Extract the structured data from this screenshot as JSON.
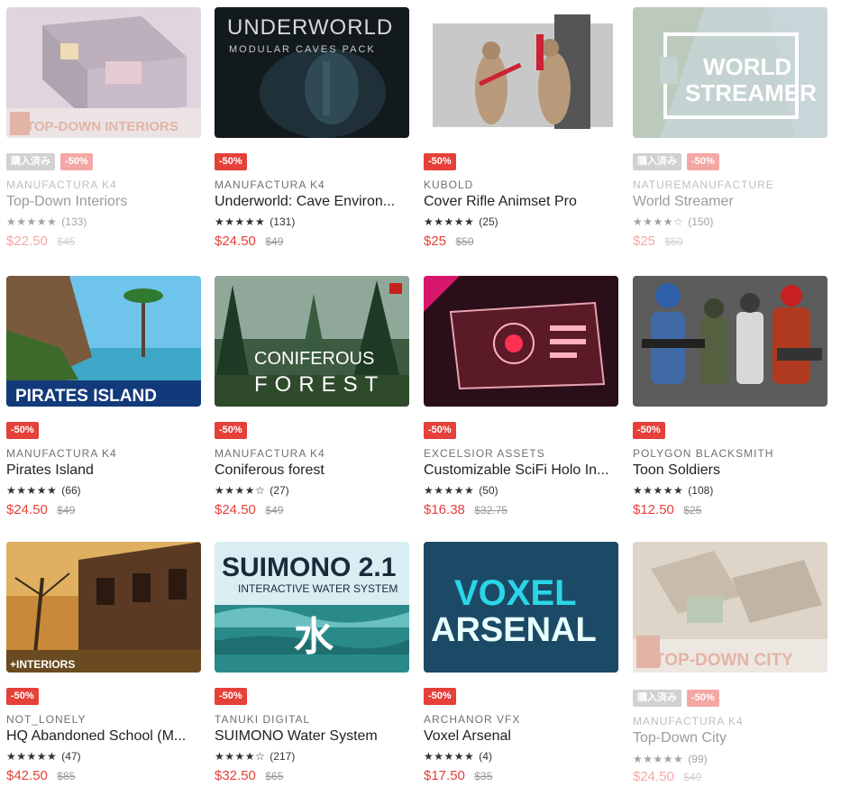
{
  "colors": {
    "sale_badge": "#e5403a",
    "owned_badge": "#9a9a9a",
    "price": "#e5403a",
    "original_price": "#999999"
  },
  "products": [
    {
      "publisher": "MANUFACTURA K4",
      "title": "Top-Down Interiors",
      "stars": "★★★★★",
      "reviews": "(133)",
      "price": "$22.50",
      "original_price": "$45",
      "owned_label": "購入済み",
      "sale_label": "-50%",
      "thumb_text": "TOP-DOWN INTERIORS",
      "thumb_icon": "interior-room-image",
      "faded": true
    },
    {
      "publisher": "MANUFACTURA K4",
      "title": "Underworld: Cave Environ...",
      "stars": "★★★★★",
      "reviews": "(131)",
      "price": "$24.50",
      "original_price": "$49",
      "sale_label": "-50%",
      "thumb_text": "UNDERWORLD",
      "thumb_subtext": "MODULAR CAVES PACK",
      "thumb_icon": "cave-image"
    },
    {
      "publisher": "KUBOLD",
      "title": "Cover Rifle Animset Pro",
      "stars": "★★★★★",
      "reviews": "(25)",
      "price": "$25",
      "original_price": "$50",
      "sale_label": "-50%",
      "thumb_icon": "soldier-figures-image"
    },
    {
      "publisher": "NATUREMANUFACTURE",
      "title": "World Streamer",
      "stars": "★★★★☆",
      "reviews": "(150)",
      "price": "$25",
      "original_price": "$50",
      "owned_label": "購入済み",
      "sale_label": "-50%",
      "thumb_text": "WORLD",
      "thumb_subtext": "STREAMER",
      "thumb_icon": "landscape-image",
      "faded": true
    },
    {
      "publisher": "MANUFACTURA K4",
      "title": "Pirates Island",
      "stars": "★★★★★",
      "reviews": "(66)",
      "price": "$24.50",
      "original_price": "$49",
      "sale_label": "-50%",
      "thumb_text": "PIRATES ISLAND",
      "thumb_icon": "island-image"
    },
    {
      "publisher": "MANUFACTURA K4",
      "title": "Coniferous forest",
      "stars": "★★★★☆",
      "reviews": "(27)",
      "price": "$24.50",
      "original_price": "$49",
      "sale_label": "-50%",
      "thumb_text": "CONIFEROUS",
      "thumb_subtext": "FOREST",
      "thumb_icon": "forest-image"
    },
    {
      "publisher": "EXCELSIOR ASSETS",
      "title": "Customizable SciFi Holo In...",
      "stars": "★★★★★",
      "reviews": "(50)",
      "price": "$16.38",
      "original_price": "$32.75",
      "sale_label": "-50%",
      "thumb_icon": "holo-interface-image"
    },
    {
      "publisher": "POLYGON BLACKSMITH",
      "title": "Toon Soldiers",
      "stars": "★★★★★",
      "reviews": "(108)",
      "price": "$12.50",
      "original_price": "$25",
      "sale_label": "-50%",
      "thumb_icon": "toon-soldiers-image"
    },
    {
      "publisher": "NOT_LONELY",
      "title": "HQ Abandoned School (M...",
      "stars": "★★★★★",
      "reviews": "(47)",
      "price": "$42.50",
      "original_price": "$85",
      "sale_label": "-50%",
      "thumb_text": "+INTERIORS",
      "thumb_icon": "school-image"
    },
    {
      "publisher": "TANUKI DIGITAL",
      "title": "SUIMONO Water System",
      "stars": "★★★★☆",
      "reviews": "(217)",
      "price": "$32.50",
      "original_price": "$65",
      "sale_label": "-50%",
      "thumb_text": "SUIMONO 2.1",
      "thumb_subtext": "INTERACTIVE WATER SYSTEM",
      "thumb_glyph": "水",
      "thumb_icon": "water-image"
    },
    {
      "publisher": "ARCHANOR VFX",
      "title": "Voxel Arsenal",
      "stars": "★★★★★",
      "reviews": "(4)",
      "price": "$17.50",
      "original_price": "$35",
      "sale_label": "-50%",
      "thumb_text": "VOXEL",
      "thumb_subtext": "ARSENAL",
      "thumb_icon": "voxel-image"
    },
    {
      "publisher": "MANUFACTURA K4",
      "title": "Top-Down City",
      "stars": "★★★★★",
      "reviews": "(99)",
      "price": "$24.50",
      "original_price": "$49",
      "owned_label": "購入済み",
      "sale_label": "-50%",
      "thumb_text": "TOP-DOWN CITY",
      "thumb_icon": "city-image",
      "faded": true
    }
  ]
}
